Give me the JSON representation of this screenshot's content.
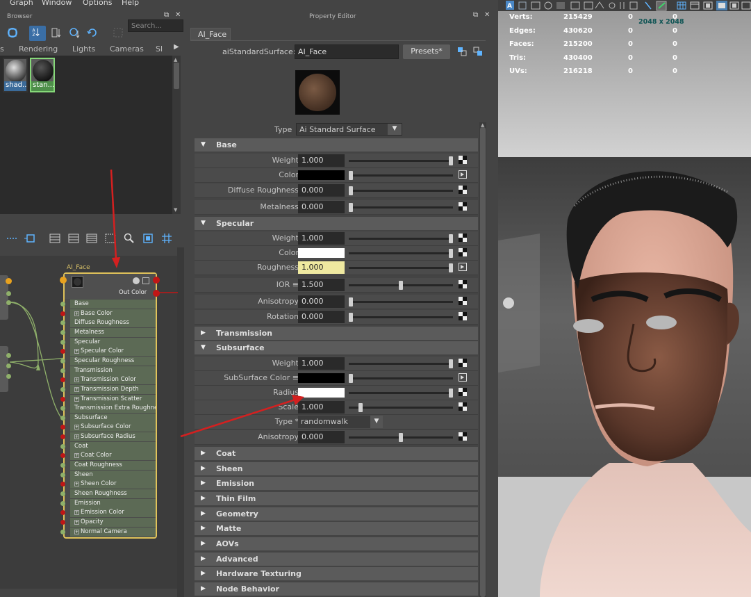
{
  "menu": [
    "Graph",
    "Window",
    "Options",
    "Help"
  ],
  "browser": {
    "title": "Browser",
    "search_placeholder": "Search...",
    "tabs": [
      "s",
      "Rendering",
      "Lights",
      "Cameras",
      "Sl"
    ],
    "swatches": [
      {
        "label": "shad..."
      },
      {
        "label": "stan..."
      }
    ]
  },
  "node": {
    "title": "AI_Face",
    "out_label": "Out Color",
    "attributes": [
      "Base",
      "Base Color",
      "Diffuse Roughness",
      "Metalness",
      "Specular",
      "Specular Color",
      "Specular Roughness",
      "Transmission",
      "Transmission Color",
      "Transmission Depth",
      "Transmission Scatter",
      "Transmission Extra Roughness",
      "Subsurface",
      "Subsurface Color",
      "Subsurface Radius",
      "Coat",
      "Coat Color",
      "Coat Roughness",
      "Sheen",
      "Sheen Color",
      "Sheen Roughness",
      "Emission",
      "Emission Color",
      "Opacity",
      "Normal Camera"
    ]
  },
  "property_editor": {
    "title": "Property Editor",
    "tab": "AI_Face",
    "node_type_label": "aiStandardSurface:",
    "node_name": "AI_Face",
    "presets_label": "Presets*",
    "type_label": "Type",
    "type_value": "Ai Standard Surface",
    "sections": {
      "base": {
        "title": "Base",
        "rows": [
          {
            "label": "Weight",
            "value": "1.000",
            "slider": 1.0
          },
          {
            "label": "Color",
            "swatch": "#000000",
            "slider": 0.0
          },
          {
            "label": "Diffuse Roughness",
            "value": "0.000",
            "slider": 0.0
          },
          {
            "label": "Metalness",
            "value": "0.000",
            "slider": 0.0
          }
        ]
      },
      "specular": {
        "title": "Specular",
        "rows": [
          {
            "label": "Weight",
            "value": "1.000",
            "slider": 1.0
          },
          {
            "label": "Color",
            "swatch": "#ffffff",
            "slider": 1.0
          },
          {
            "label": "Roughness",
            "value": "1.000",
            "slider": 1.0
          },
          {
            "label": "IOR ≡",
            "value": "1.500",
            "slider": 0.5
          },
          {
            "label": "Anisotropy",
            "value": "0.000",
            "slider": 0.0
          },
          {
            "label": "Rotation",
            "value": "0.000",
            "slider": 0.0
          }
        ]
      },
      "transmission": {
        "title": "Transmission"
      },
      "subsurface": {
        "title": "Subsurface",
        "rows": [
          {
            "label": "Weight",
            "value": "1.000",
            "slider": 1.0
          },
          {
            "label": "SubSurface Color ≡",
            "swatch": "#000000",
            "slider": 0.0
          },
          {
            "label": "Radius",
            "swatch": "#ffffff",
            "slider": 1.0
          },
          {
            "label": "Scale",
            "value": "1.000",
            "slider": 0.1
          },
          {
            "label": "Type *",
            "dropdown": "randomwalk"
          },
          {
            "label": "Anisotropy",
            "value": "0.000",
            "slider": 0.5
          }
        ]
      },
      "collapsed": [
        "Coat",
        "Sheen",
        "Emission",
        "Thin Film",
        "Geometry",
        "Matte",
        "AOVs",
        "Advanced",
        "Hardware Texturing",
        "Node Behavior"
      ]
    }
  },
  "viewport": {
    "stats": [
      {
        "label": "Verts:",
        "value": "215429",
        "a": "0",
        "b": "0"
      },
      {
        "label": "Edges:",
        "value": "430620",
        "a": "0",
        "b": "0"
      },
      {
        "label": "Faces:",
        "value": "215200",
        "a": "0",
        "b": "0"
      },
      {
        "label": "Tris:",
        "value": "430400",
        "a": "0",
        "b": "0"
      },
      {
        "label": "UVs:",
        "value": "216218",
        "a": "0",
        "b": "0"
      }
    ],
    "resolution": "2048 x 2048"
  },
  "colors": {
    "accent_blue": "#4a7fb0",
    "node_border": "#e0c25a",
    "highlight_field": "#efe9a0",
    "annotation_arrow": "#d42020"
  }
}
